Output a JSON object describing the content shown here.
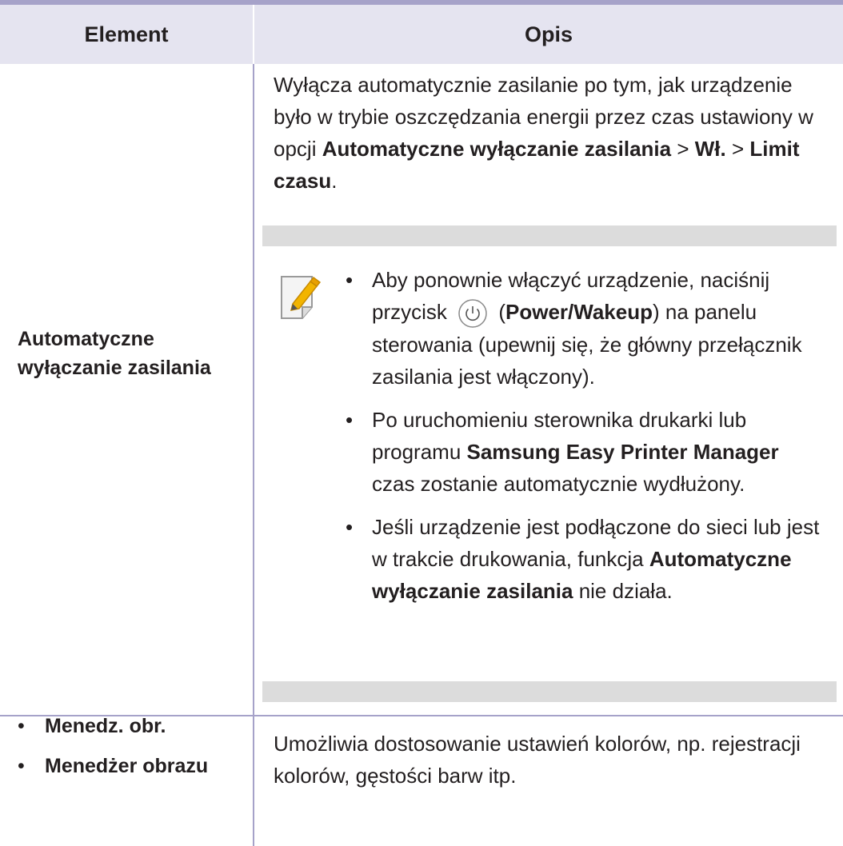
{
  "table": {
    "header": {
      "element": "Element",
      "description": "Opis"
    },
    "row1": {
      "label": "Automatyczne wyłączanie zasilania",
      "desc_p1": "Wyłącza automatycznie zasilanie po tym, jak urządzenie było w trybie oszczędzania energii przez czas ustawiony w opcji ",
      "desc_b1": "Automatyczne wyłączanie zasilania",
      "desc_p2": " > ",
      "desc_b2": "Wł.",
      "desc_p3": " > ",
      "desc_b3": "Limit czasu",
      "desc_p4": ".",
      "note": {
        "bullet1_a": "Aby ponownie włączyć urządzenie, naciśnij przycisk ",
        "bullet1_b_open": " (",
        "bullet1_bold": "Power/Wakeup",
        "bullet1_c": ") na panelu sterowania (upewnij się, że główny przełącznik zasilania jest włączony).",
        "bullet2_a": "Po uruchomieniu sterownika drukarki lub programu ",
        "bullet2_bold": "Samsung Easy Printer Manager",
        "bullet2_b": " czas zostanie automatycznie wydłużony.",
        "bullet3_a": "Jeśli urządzenie jest podłączone do sieci lub jest w trakcie drukowania, funkcja ",
        "bullet3_bold": "Automatyczne wyłączanie zasilania",
        "bullet3_b": " nie działa."
      }
    },
    "row2": {
      "items": [
        "Menedz. obr.",
        "Menedżer obrazu"
      ],
      "desc": "Umożliwia dostosowanie ustawień kolorów, np. rejestracji kolorów, gęstości barw itp."
    }
  },
  "colors": {
    "accent": "#a6a2c9",
    "header_bg": "#e5e4f0",
    "note_bar": "#dcdcdc"
  },
  "icons": [
    "note-pencil-icon",
    "power-icon"
  ]
}
